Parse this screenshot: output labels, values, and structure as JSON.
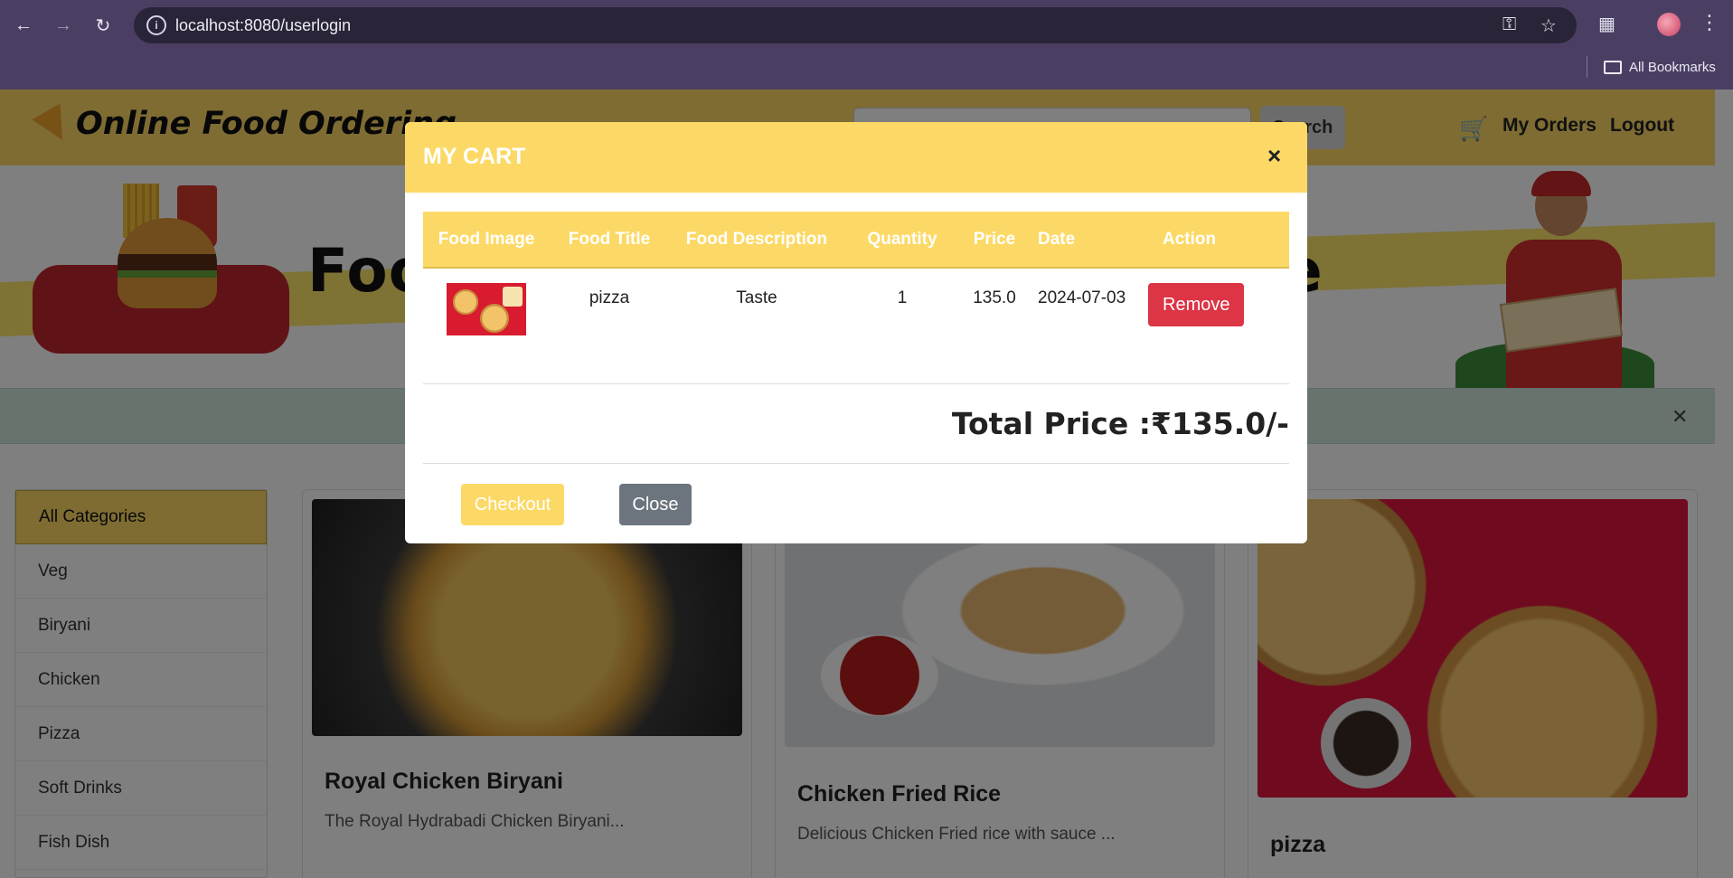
{
  "browser": {
    "url": "localhost:8080/userlogin",
    "bookmarks_label": "All Bookmarks"
  },
  "site": {
    "brand": "Online Food Ordering",
    "search_button": "Search",
    "nav": {
      "my_orders": "My Orders",
      "logout": "Logout"
    },
    "banner_text_left": "Foo",
    "banner_text_right": "e"
  },
  "sidebar": {
    "categories": [
      "All Categories",
      "Veg",
      "Biryani",
      "Chicken",
      "Pizza",
      "Soft Drinks",
      "Fish Dish"
    ]
  },
  "cards": [
    {
      "title": "Royal Chicken Biryani",
      "desc": "The Royal Hydrabadi Chicken Biryani..."
    },
    {
      "title": "Chicken Fried Rice",
      "desc": "Delicious Chicken Fried rice with sauce ..."
    },
    {
      "title": "pizza",
      "desc": ""
    }
  ],
  "modal": {
    "title": "MY CART",
    "close_x": "×",
    "columns": [
      "Food Image",
      "Food Title",
      "Food Description",
      "Quantity",
      "Price",
      "Date",
      "Action"
    ],
    "rows": [
      {
        "title": "pizza",
        "description": "Taste",
        "quantity": "1",
        "price": "135.0",
        "date": "2024-07-03",
        "action": "Remove"
      }
    ],
    "total": "Total Price :₹135.0/-",
    "checkout_label": "Checkout",
    "close_label": "Close"
  },
  "colors": {
    "primary_yellow": "#fcd966",
    "danger": "#dc3545",
    "secondary": "#6c757d"
  },
  "icons": [
    "back-icon",
    "forward-icon",
    "reload-icon",
    "site-info-icon",
    "key-icon",
    "star-icon",
    "extensions-icon",
    "menu-icon",
    "folder-icon",
    "cart-icon",
    "close-icon"
  ]
}
